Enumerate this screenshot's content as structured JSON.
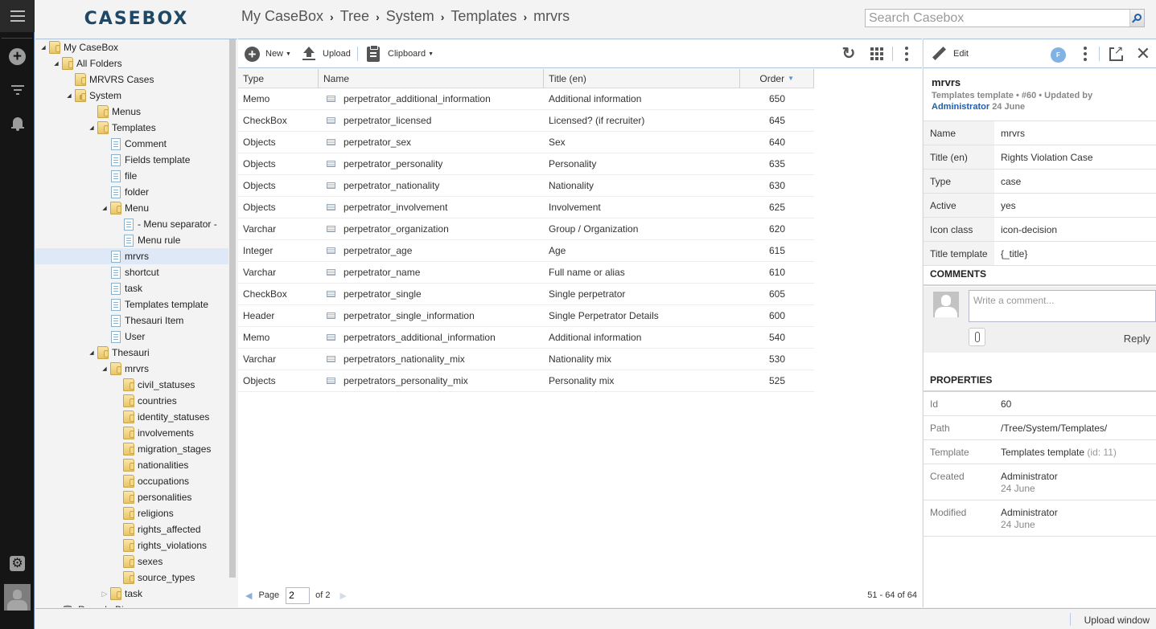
{
  "app": {
    "logo": "CASEBOX"
  },
  "rail": {
    "icons": [
      "menu-icon",
      "plus-icon",
      "filter-icon",
      "bell-icon",
      "gear-icon",
      "user-avatar"
    ]
  },
  "breadcrumb": [
    "My CaseBox",
    "Tree",
    "System",
    "Templates",
    "mrvrs"
  ],
  "search": {
    "placeholder": "Search Casebox",
    "value": ""
  },
  "tree": {
    "nodes": [
      {
        "label": "My CaseBox",
        "level": 0,
        "icon": "folder",
        "toggle": "open"
      },
      {
        "label": "All Folders",
        "level": 1,
        "icon": "folder",
        "toggle": "open"
      },
      {
        "label": "MRVRS Cases",
        "level": 2,
        "icon": "folder",
        "toggle": "none"
      },
      {
        "label": "System",
        "level": 2,
        "icon": "folder-locked",
        "toggle": "open"
      },
      {
        "label": "Menus",
        "level": 3,
        "icon": "folder",
        "toggle": "none"
      },
      {
        "label": "Templates",
        "level": 3,
        "icon": "folder",
        "toggle": "open"
      },
      {
        "label": "Comment",
        "level": 4,
        "icon": "template",
        "toggle": "none"
      },
      {
        "label": "Fields template",
        "level": 4,
        "icon": "template",
        "toggle": "none"
      },
      {
        "label": "file",
        "level": 4,
        "icon": "template",
        "toggle": "none"
      },
      {
        "label": "folder",
        "level": 4,
        "icon": "template",
        "toggle": "none"
      },
      {
        "label": "Menu",
        "level": 4,
        "icon": "folder",
        "toggle": "open"
      },
      {
        "label": "- Menu separator -",
        "level": 5,
        "icon": "template",
        "toggle": "none"
      },
      {
        "label": "Menu rule",
        "level": 5,
        "icon": "template",
        "toggle": "none"
      },
      {
        "label": "mrvrs",
        "level": 4,
        "icon": "template",
        "toggle": "none",
        "selected": true
      },
      {
        "label": "shortcut",
        "level": 4,
        "icon": "template",
        "toggle": "none"
      },
      {
        "label": "task",
        "level": 4,
        "icon": "template",
        "toggle": "none"
      },
      {
        "label": "Templates template",
        "level": 4,
        "icon": "template",
        "toggle": "none"
      },
      {
        "label": "Thesauri Item",
        "level": 4,
        "icon": "template",
        "toggle": "none"
      },
      {
        "label": "User",
        "level": 4,
        "icon": "template",
        "toggle": "none"
      },
      {
        "label": "Thesauri",
        "level": 3,
        "icon": "folder",
        "toggle": "open"
      },
      {
        "label": "mrvrs",
        "level": 4,
        "icon": "folder",
        "toggle": "open"
      },
      {
        "label": "civil_statuses",
        "level": 5,
        "icon": "folder",
        "toggle": "none"
      },
      {
        "label": "countries",
        "level": 5,
        "icon": "folder",
        "toggle": "none"
      },
      {
        "label": "identity_statuses",
        "level": 5,
        "icon": "folder",
        "toggle": "none"
      },
      {
        "label": "involvements",
        "level": 5,
        "icon": "folder",
        "toggle": "none"
      },
      {
        "label": "migration_stages",
        "level": 5,
        "icon": "folder",
        "toggle": "none"
      },
      {
        "label": "nationalities",
        "level": 5,
        "icon": "folder",
        "toggle": "none"
      },
      {
        "label": "occupations",
        "level": 5,
        "icon": "folder",
        "toggle": "none"
      },
      {
        "label": "personalities",
        "level": 5,
        "icon": "folder",
        "toggle": "none"
      },
      {
        "label": "religions",
        "level": 5,
        "icon": "folder",
        "toggle": "none"
      },
      {
        "label": "rights_affected",
        "level": 5,
        "icon": "folder",
        "toggle": "none"
      },
      {
        "label": "rights_violations",
        "level": 5,
        "icon": "folder",
        "toggle": "none"
      },
      {
        "label": "sexes",
        "level": 5,
        "icon": "folder",
        "toggle": "none"
      },
      {
        "label": "source_types",
        "level": 5,
        "icon": "folder",
        "toggle": "none"
      },
      {
        "label": "task",
        "level": 4,
        "icon": "folder",
        "toggle": "closed"
      },
      {
        "label": "Recycle Bin",
        "level": 1,
        "icon": "bin",
        "toggle": "closed"
      }
    ]
  },
  "toolbar": {
    "new_label": "New",
    "upload_label": "Upload",
    "clipboard_label": "Clipboard"
  },
  "table": {
    "columns": {
      "type": "Type",
      "name": "Name",
      "title": "Title (en)",
      "order": "Order"
    },
    "sort": {
      "column": "order",
      "direction": "desc"
    },
    "rows": [
      {
        "type": "Memo",
        "name": "perpetrator_additional_information",
        "title": "Additional information",
        "order": "650"
      },
      {
        "type": "CheckBox",
        "name": "perpetrator_licensed",
        "title": "Licensed? (if recruiter)",
        "order": "645"
      },
      {
        "type": "Objects",
        "name": "perpetrator_sex",
        "title": "Sex",
        "order": "640"
      },
      {
        "type": "Objects",
        "name": "perpetrator_personality",
        "title": "Personality",
        "order": "635"
      },
      {
        "type": "Objects",
        "name": "perpetrator_nationality",
        "title": "Nationality",
        "order": "630"
      },
      {
        "type": "Objects",
        "name": "perpetrator_involvement",
        "title": "Involvement",
        "order": "625"
      },
      {
        "type": "Varchar",
        "name": "perpetrator_organization",
        "title": "Group / Organization",
        "order": "620"
      },
      {
        "type": "Integer",
        "name": "perpetrator_age",
        "title": "Age",
        "order": "615"
      },
      {
        "type": "Varchar",
        "name": "perpetrator_name",
        "title": "Full name or alias",
        "order": "610"
      },
      {
        "type": "CheckBox",
        "name": "perpetrator_single",
        "title": "Single perpetrator",
        "order": "605"
      },
      {
        "type": "Header",
        "name": "perpetrator_single_information",
        "title": "Single Perpetrator Details",
        "order": "600"
      },
      {
        "type": "Memo",
        "name": "perpetrators_additional_information",
        "title": "Additional information",
        "order": "540"
      },
      {
        "type": "Varchar",
        "name": "perpetrators_nationality_mix",
        "title": "Nationality mix",
        "order": "530"
      },
      {
        "type": "Objects",
        "name": "perpetrators_personality_mix",
        "title": "Personality mix",
        "order": "525"
      }
    ]
  },
  "pager": {
    "page_label": "Page",
    "page_value": "2",
    "of_label": "of 2",
    "count": "51 - 64 of 64"
  },
  "details": {
    "edit_label": "Edit",
    "user_badge": "F",
    "title": "mrvrs",
    "subtitle": "Templates template • #60 • Updated by",
    "updated_by": "Administrator",
    "updated_date": "24 June",
    "fields": [
      {
        "key": "Name",
        "value": "mrvrs"
      },
      {
        "key": "Title (en)",
        "value": "Rights Violation Case"
      },
      {
        "key": "Type",
        "value": "case"
      },
      {
        "key": "Active",
        "value": "yes"
      },
      {
        "key": "Icon class",
        "value": "icon-decision"
      },
      {
        "key": "Title template",
        "value": "{_title}"
      }
    ],
    "comments": {
      "heading": "COMMENTS",
      "placeholder": "Write a comment...",
      "reply_label": "Reply"
    },
    "properties": {
      "heading": "PROPERTIES",
      "id_key": "Id",
      "id_value": "60",
      "path_key": "Path",
      "path_value": "/Tree/System/Templates/",
      "template_key": "Template",
      "template_value": "Templates template",
      "template_id": "(id: 11)",
      "created_key": "Created",
      "created_by": "Administrator",
      "created_date": "24 June",
      "modified_key": "Modified",
      "modified_by": "Administrator",
      "modified_date": "24 June"
    }
  },
  "statusbar": {
    "upload_window": "Upload window"
  },
  "colors": {
    "rail_bg": "#151515",
    "logo": "#1e4866",
    "accent_link": "#1f5fa6",
    "selected_row": "#dfe8f6",
    "border_blue": "#a9c0d8"
  }
}
